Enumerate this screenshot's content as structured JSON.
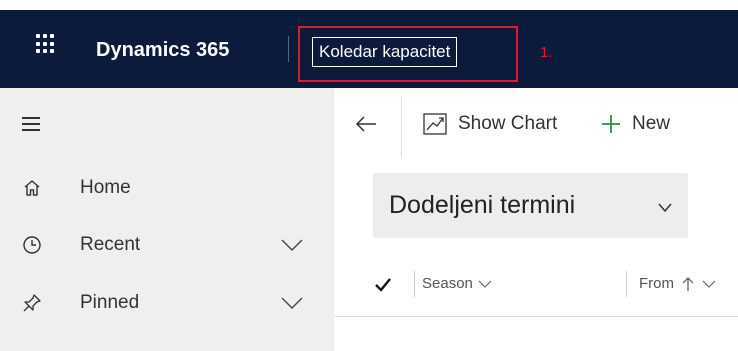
{
  "topbar": {
    "app_name": "Dynamics 365",
    "area_title": "Koledar kapacitet",
    "annotation": "1.",
    "bg_color": "#0c1a3c",
    "highlight_color": "#e0192b"
  },
  "sidebar": {
    "items": [
      {
        "label": "Home",
        "icon": "home-icon"
      },
      {
        "label": "Recent",
        "icon": "clock-icon",
        "expandable": true
      },
      {
        "label": "Pinned",
        "icon": "pin-icon",
        "expandable": true
      }
    ]
  },
  "commandbar": {
    "show_chart_label": "Show Chart",
    "new_label": "New"
  },
  "view": {
    "title": "Dodeljeni termini"
  },
  "grid": {
    "columns": [
      {
        "label": "Season",
        "icon": "chevron-down-icon"
      },
      {
        "label": "From",
        "icon": "sort-ascending-icon"
      }
    ]
  }
}
